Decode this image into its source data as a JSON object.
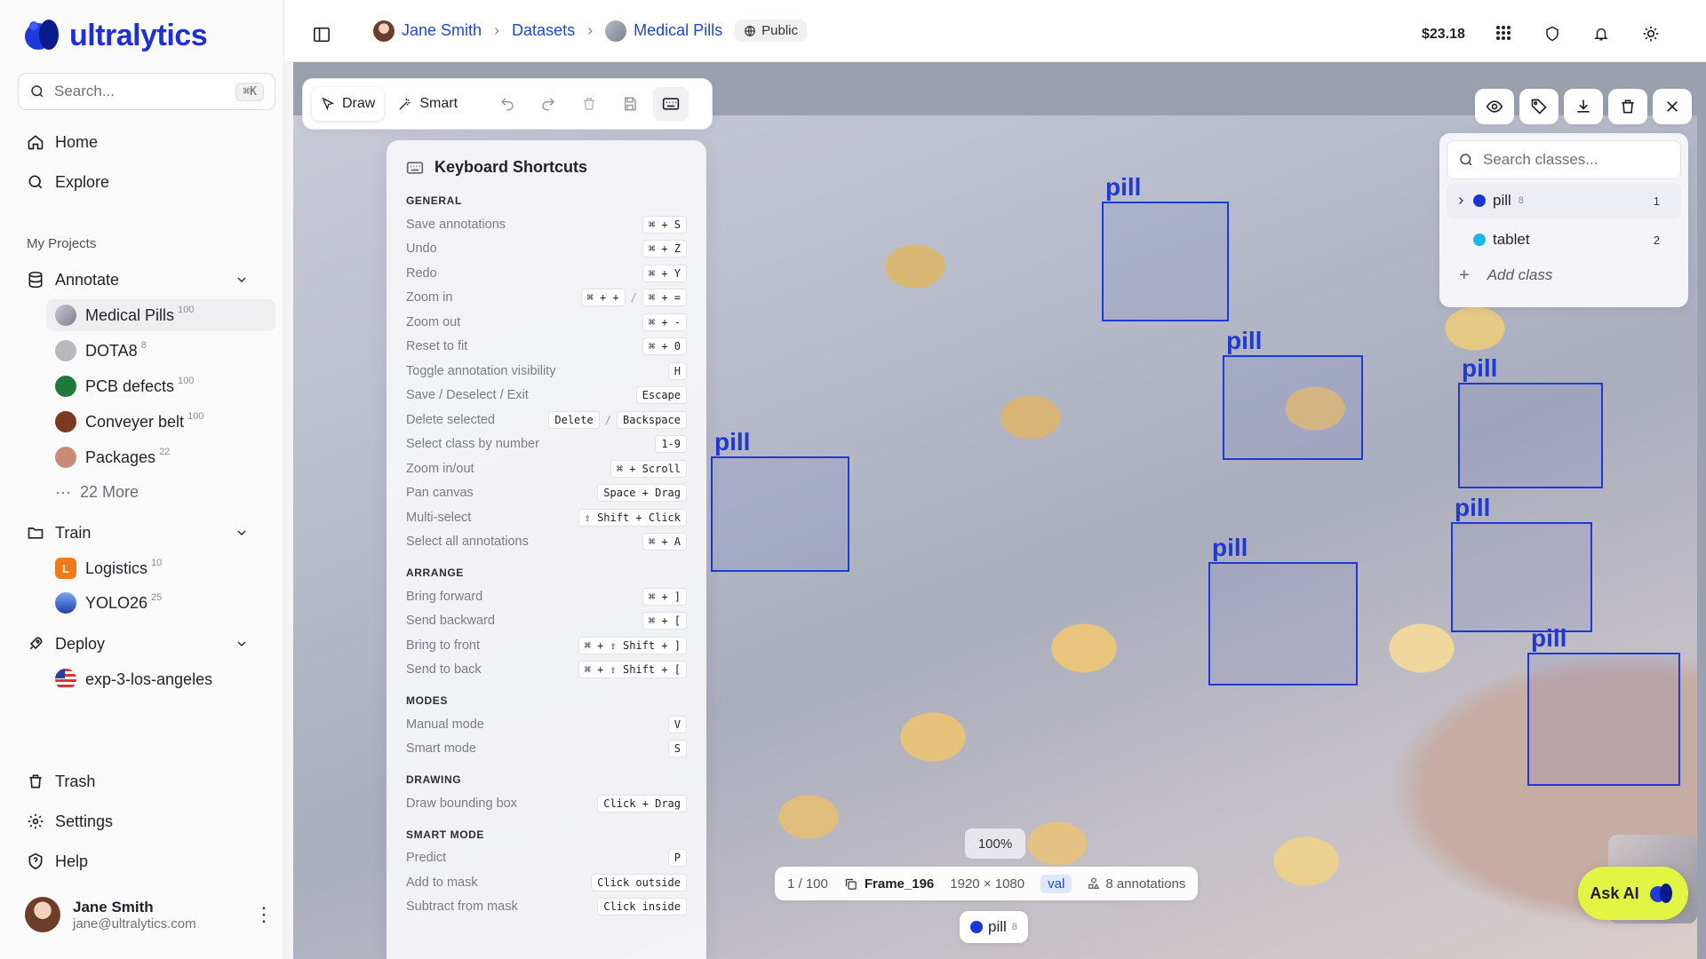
{
  "brand": {
    "name": "ultralytics"
  },
  "sidebar": {
    "search_placeholder": "Search...",
    "search_shortcut": "⌘K",
    "nav": [
      {
        "label": "Home",
        "icon": "home-icon"
      },
      {
        "label": "Explore",
        "icon": "search-icon"
      }
    ],
    "projects_label": "My Projects",
    "annotate": {
      "label": "Annotate",
      "items": [
        {
          "label": "Medical Pills",
          "count": "100",
          "color": "#8d8f9c"
        },
        {
          "label": "DOTA8",
          "count": "8",
          "color": "#b7babd"
        },
        {
          "label": "PCB defects",
          "count": "100",
          "color": "#1d7a3a"
        },
        {
          "label": "Conveyer belt",
          "count": "100",
          "color": "#7a3a22"
        },
        {
          "label": "Packages",
          "count": "22",
          "color": "#c98a7a"
        }
      ],
      "more": "22 More"
    },
    "train": {
      "label": "Train",
      "items": [
        {
          "label": "Logistics",
          "count": "10",
          "color": "#f07a1a",
          "letter": "L"
        },
        {
          "label": "YOLO26",
          "count": "25",
          "color": "#3a6fd6"
        }
      ]
    },
    "deploy": {
      "label": "Deploy",
      "items": [
        {
          "label": "exp-3-los-angeles"
        }
      ]
    },
    "bottom": [
      {
        "label": "Trash",
        "icon": "trash-icon"
      },
      {
        "label": "Settings",
        "icon": "gear-icon"
      },
      {
        "label": "Help",
        "icon": "help-icon"
      }
    ],
    "user": {
      "name": "Jane Smith",
      "email": "jane@ultralytics.com"
    }
  },
  "topbar": {
    "crumbs": [
      "Jane Smith",
      "Datasets",
      "Medical Pills"
    ],
    "visibility": "Public",
    "credit": "$23.18"
  },
  "toolbar": {
    "draw": "Draw",
    "smart": "Smart"
  },
  "shortcuts": {
    "title": "Keyboard Shortcuts",
    "sections": [
      {
        "name": "GENERAL",
        "rows": [
          {
            "label": "Save annotations",
            "keys": [
              "⌘ + S"
            ]
          },
          {
            "label": "Undo",
            "keys": [
              "⌘ + Z"
            ]
          },
          {
            "label": "Redo",
            "keys": [
              "⌘ + Y"
            ]
          },
          {
            "label": "Zoom in",
            "keys": [
              "⌘ + +",
              "⌘ + ="
            ]
          },
          {
            "label": "Zoom out",
            "keys": [
              "⌘ + -"
            ]
          },
          {
            "label": "Reset to fit",
            "keys": [
              "⌘ + 0"
            ]
          },
          {
            "label": "Toggle annotation visibility",
            "keys": [
              "H"
            ]
          },
          {
            "label": "Save / Deselect / Exit",
            "keys": [
              "Escape"
            ]
          },
          {
            "label": "Delete selected",
            "keys": [
              "Delete",
              "Backspace"
            ]
          },
          {
            "label": "Select class by number",
            "keys": [
              "1-9"
            ]
          },
          {
            "label": "Zoom in/out",
            "keys": [
              "⌘ + Scroll"
            ]
          },
          {
            "label": "Pan canvas",
            "keys": [
              "Space + Drag"
            ]
          },
          {
            "label": "Multi-select",
            "keys": [
              "⇧ Shift + Click"
            ]
          },
          {
            "label": "Select all annotations",
            "keys": [
              "⌘ + A"
            ]
          }
        ]
      },
      {
        "name": "ARRANGE",
        "rows": [
          {
            "label": "Bring forward",
            "keys": [
              "⌘ + ]"
            ]
          },
          {
            "label": "Send backward",
            "keys": [
              "⌘ + ["
            ]
          },
          {
            "label": "Bring to front",
            "keys": [
              "⌘ + ⇧ Shift + ]"
            ]
          },
          {
            "label": "Send to back",
            "keys": [
              "⌘ + ⇧ Shift + ["
            ]
          }
        ]
      },
      {
        "name": "MODES",
        "rows": [
          {
            "label": "Manual mode",
            "keys": [
              "V"
            ]
          },
          {
            "label": "Smart mode",
            "keys": [
              "S"
            ]
          }
        ]
      },
      {
        "name": "DRAWING",
        "rows": [
          {
            "label": "Draw bounding box",
            "keys": [
              "Click + Drag"
            ]
          }
        ]
      },
      {
        "name": "SMART MODE",
        "rows": [
          {
            "label": "Predict",
            "keys": [
              "P"
            ]
          },
          {
            "label": "Add to mask",
            "keys": [
              "Click outside"
            ]
          },
          {
            "label": "Subtract from mask",
            "keys": [
              "Click inside"
            ]
          }
        ]
      }
    ]
  },
  "classes": {
    "search_placeholder": "Search classes...",
    "items": [
      {
        "label": "pill",
        "sup": "8",
        "number": "1",
        "color": "#1736d8"
      },
      {
        "label": "tablet",
        "sup": "",
        "number": "2",
        "color": "#19b8e6"
      }
    ],
    "add_label": "Add class"
  },
  "annotations": {
    "label": "pill",
    "color": "#1f38d6"
  },
  "footer": {
    "zoom": "100%",
    "position": "1 / 100",
    "frame": "Frame_196",
    "resolution": "1920 × 1080",
    "split": "val",
    "annotation_count": "8 annotations",
    "active_class": "pill",
    "active_class_count": "8"
  },
  "ask_ai": "Ask AI"
}
